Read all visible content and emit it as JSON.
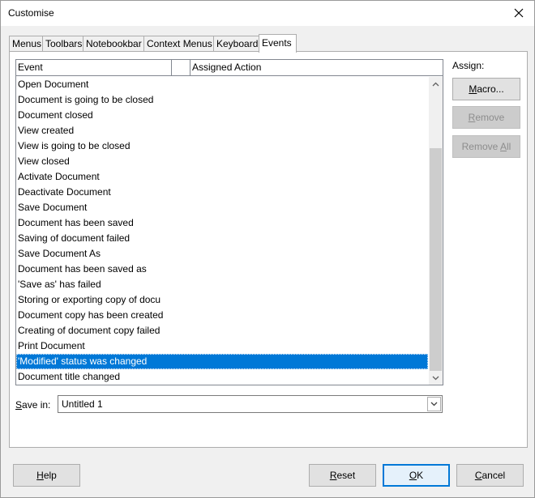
{
  "window": {
    "title": "Customise"
  },
  "tabs": [
    "Menus",
    "Toolbars",
    "Notebookbar",
    "Context Menus",
    "Keyboard",
    "Events"
  ],
  "active_tab": "Events",
  "list": {
    "columns": [
      "Event",
      "Assigned Action"
    ],
    "rows": [
      "Open Document",
      "Document is going to be closed",
      "Document closed",
      "View created",
      "View is going to be closed",
      "View closed",
      "Activate Document",
      "Deactivate Document",
      "Save Document",
      "Document has been saved",
      "Saving of document failed",
      "Save Document As",
      "Document has been saved as",
      "'Save as' has failed",
      "Storing or exporting copy of docu",
      "Document copy has been created",
      "Creating of document copy failed",
      "Print Document",
      "'Modified' status was changed",
      "Document title changed"
    ],
    "selected_index": 18
  },
  "assign": {
    "label": "Assign:",
    "macro": {
      "pre": "",
      "ul": "M",
      "post": "acro..."
    },
    "remove": {
      "pre": "",
      "ul": "R",
      "post": "emove"
    },
    "remove_all": {
      "pre": "Remove ",
      "ul": "A",
      "post": "ll"
    }
  },
  "save_in": {
    "label_ul": "S",
    "label_rest": "ave in:",
    "value": "Untitled 1"
  },
  "footer": {
    "help": {
      "ul": "H",
      "post": "elp"
    },
    "reset": {
      "ul": "R",
      "post": "eset"
    },
    "ok": {
      "ul": "O",
      "post": "K"
    },
    "cancel": {
      "ul": "C",
      "post": "ancel"
    }
  }
}
